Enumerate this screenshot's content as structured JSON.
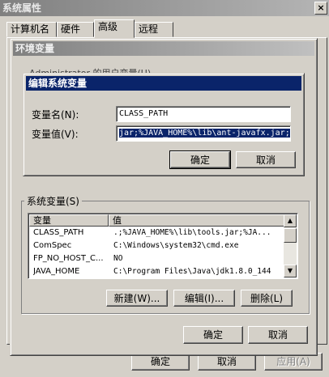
{
  "sysprops": {
    "title": "系统属性",
    "close": "×",
    "tabs": [
      "计算机名",
      "硬件",
      "高级",
      "远程"
    ],
    "buttons": {
      "ok": "确定",
      "cancel": "取消",
      "apply": "应用(A)"
    }
  },
  "env": {
    "title": "环境变量",
    "user_group_partial": "Administrator 的用户变量(U)",
    "system_group": "系统变量(S)",
    "columns": [
      "变量",
      "值"
    ],
    "rows": [
      {
        "name": "CLASS_PATH",
        "value": ".;%JAVA_HOME%\\lib\\tools.jar;%JA..."
      },
      {
        "name": "ComSpec",
        "value": "C:\\Windows\\system32\\cmd.exe"
      },
      {
        "name": "FP_NO_HOST_C...",
        "value": "NO"
      },
      {
        "name": "JAVA_HOME",
        "value": "C:\\Program Files\\Java\\jdk1.8.0_144"
      }
    ],
    "buttons": {
      "new": "新建(W)...",
      "edit": "编辑(I)...",
      "delete": "删除(L)",
      "ok": "确定",
      "cancel": "取消"
    }
  },
  "edit": {
    "title": "编辑系统变量",
    "name_label": "变量名(N):",
    "value_label": "变量值(V):",
    "name_value": "CLASS_PATH",
    "value_value": "jar;%JAVA_HOME%\\lib\\ant-javafx.jar;",
    "ok": "确定",
    "cancel": "取消"
  }
}
